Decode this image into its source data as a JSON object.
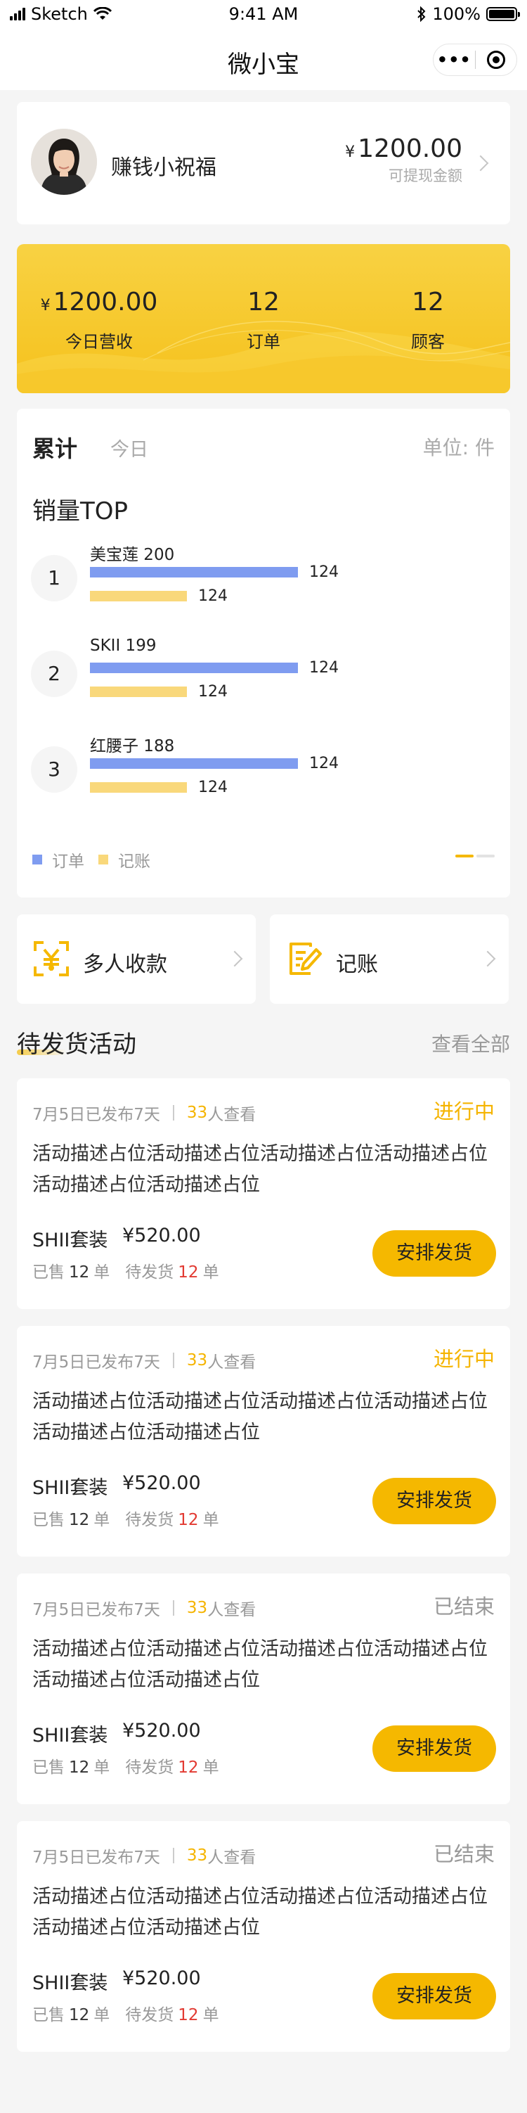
{
  "status_bar": {
    "carrier": "Sketch",
    "time": "9:41 AM",
    "battery": "100%",
    "battery_level": 1.0,
    "icons": [
      "signal-icon",
      "wifi-icon",
      "bluetooth-icon",
      "battery-icon"
    ]
  },
  "nav": {
    "title": "微小宝",
    "more_glyph": "•••",
    "icons": [
      "more-icon",
      "close-target-icon"
    ]
  },
  "profile": {
    "name": "赚钱小祝福",
    "currency": "¥",
    "balance": "1200.00",
    "balance_label": "可提现金额"
  },
  "stats": [
    {
      "currency": "¥",
      "value": "1200.00",
      "label": "今日营收"
    },
    {
      "currency": "",
      "value": "12",
      "label": "订单"
    },
    {
      "currency": "",
      "value": "12",
      "label": "顾客"
    }
  ],
  "ranking": {
    "tab_active": "累计",
    "tab_inactive": "今日",
    "unit": "单位: 件",
    "title": "销量TOP",
    "items": [
      {
        "rank": "1",
        "name": "美宝莲 200",
        "orders": 124,
        "orders_label": "124",
        "bookkeeping": 124,
        "bookkeeping_label": "124"
      },
      {
        "rank": "2",
        "name": "SKII 199",
        "orders": 124,
        "orders_label": "124",
        "bookkeeping": 124,
        "bookkeeping_label": "124"
      },
      {
        "rank": "3",
        "name": "红腰子 188",
        "orders": 124,
        "orders_label": "124",
        "bookkeeping": 124,
        "bookkeeping_label": "124"
      }
    ],
    "legend": {
      "orders": "订单",
      "bookkeeping": "记账"
    },
    "colors": {
      "orders": "#7f9cf0",
      "bookkeeping": "#f9d87b"
    },
    "pager": {
      "pages": 2,
      "active": 1
    }
  },
  "entries": [
    {
      "label": "多人收款",
      "icon": "group-collect-icon"
    },
    {
      "label": "记账",
      "icon": "bookkeeping-icon"
    }
  ],
  "section": {
    "title": "待发货活动",
    "view_all": "查看全部"
  },
  "activities": [
    {
      "published": "7月5日已发布7天",
      "views": "33",
      "views_suffix": "人查看",
      "status": "进行中",
      "status_color": "#f5b400",
      "description": "活动描述占位活动描述占位活动描述占位活动描述占位活动描述占位活动描述占位",
      "product": "SHII套装",
      "price": "¥520.00",
      "sold_label": "已售",
      "sold": "12",
      "pending_label": "待发货",
      "pending": "12",
      "unit": "单",
      "button": "安排发货"
    },
    {
      "published": "7月5日已发布7天",
      "views": "33",
      "views_suffix": "人查看",
      "status": "进行中",
      "status_color": "#f5b400",
      "description": "活动描述占位活动描述占位活动描述占位活动描述占位活动描述占位活动描述占位",
      "product": "SHII套装",
      "price": "¥520.00",
      "sold_label": "已售",
      "sold": "12",
      "pending_label": "待发货",
      "pending": "12",
      "unit": "单",
      "button": "安排发货"
    },
    {
      "published": "7月5日已发布7天",
      "views": "33",
      "views_suffix": "人查看",
      "status": "已结束",
      "status_color": "#999999",
      "description": "活动描述占位活动描述占位活动描述占位活动描述占位活动描述占位活动描述占位",
      "product": "SHII套装",
      "price": "¥520.00",
      "sold_label": "已售",
      "sold": "12",
      "pending_label": "待发货",
      "pending": "12",
      "unit": "单",
      "button": "安排发货"
    },
    {
      "published": "7月5日已发布7天",
      "views": "33",
      "views_suffix": "人查看",
      "status": "已结束",
      "status_color": "#999999",
      "description": "活动描述占位活动描述占位活动描述占位活动描述占位活动描述占位活动描述占位",
      "product": "SHII套装",
      "price": "¥520.00",
      "sold_label": "已售",
      "sold": "12",
      "pending_label": "待发货",
      "pending": "12",
      "unit": "单",
      "button": "安排发货"
    }
  ]
}
